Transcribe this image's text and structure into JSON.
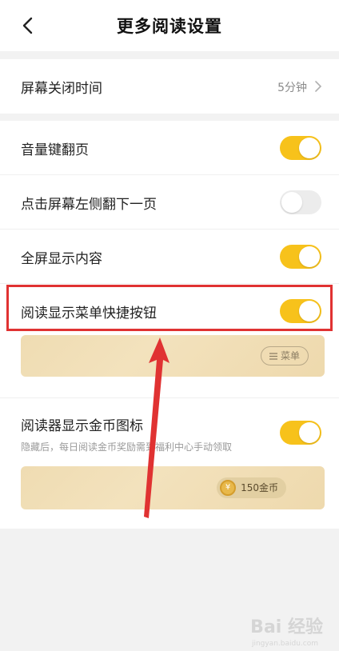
{
  "header": {
    "title": "更多阅读设置",
    "back_icon": "chevron-left-icon"
  },
  "screen_timeout": {
    "label": "屏幕关闭时间",
    "value": "5分钟"
  },
  "settings": [
    {
      "label": "音量键翻页",
      "state": "on"
    },
    {
      "label": "点击屏幕左侧翻下一页",
      "state": "off"
    },
    {
      "label": "全屏显示内容",
      "state": "on"
    },
    {
      "label": "阅读显示菜单快捷按钮",
      "state": "on"
    }
  ],
  "menu_preview": {
    "pill_icon": "menu-lines-icon",
    "pill_label": "菜单"
  },
  "coin_setting": {
    "label": "阅读器显示金币图标",
    "description": "隐藏后，每日阅读金币奖励需到福利中心手动领取",
    "state": "on"
  },
  "coin_preview": {
    "coin_symbol": "¥",
    "amount": "150金币"
  },
  "watermark": {
    "text": "Bai 经验",
    "sub": "jingyan.baidu.com"
  },
  "colors": {
    "toggle_on": "#f7c21b",
    "toggle_off": "#ececec",
    "highlight": "#e03232",
    "arrow": "#e03232"
  }
}
